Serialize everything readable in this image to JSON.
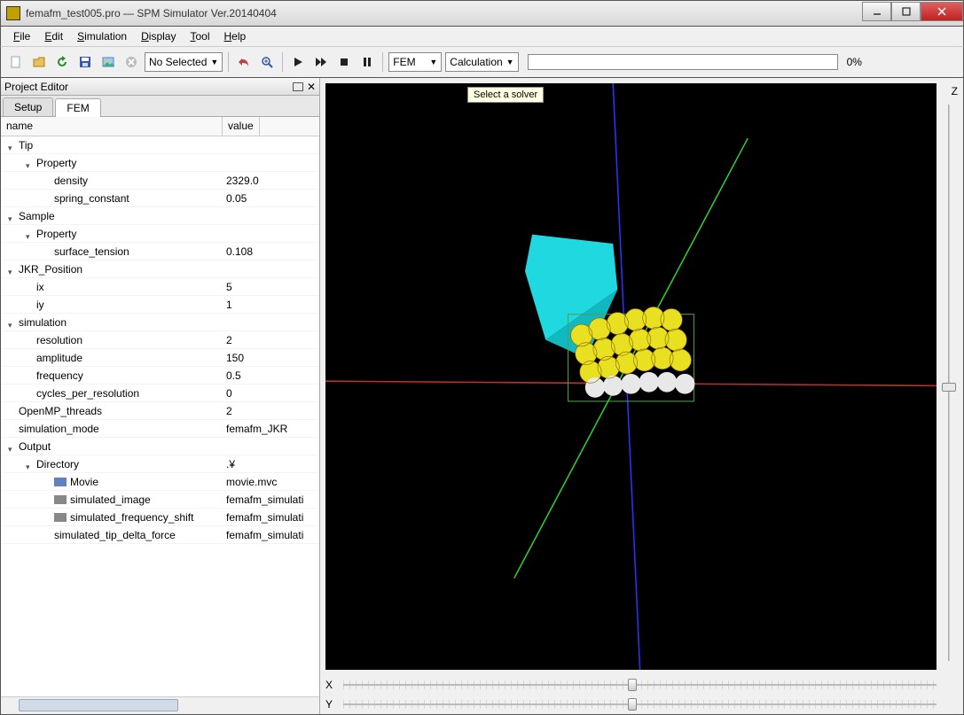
{
  "window": {
    "title": "femafm_test005.pro — SPM Simulator Ver.20140404"
  },
  "menu": {
    "file": "File",
    "edit": "Edit",
    "simulation": "Simulation",
    "display": "Display",
    "tool": "Tool",
    "help": "Help"
  },
  "toolbar": {
    "combo_noselected": "No Selected",
    "solver": "FEM",
    "mode": "Calculation",
    "progress_pct": "0%"
  },
  "panel": {
    "title": "Project Editor",
    "tab_setup": "Setup",
    "tab_fem": "FEM",
    "col_name": "name",
    "col_value": "value"
  },
  "tree": [
    {
      "indent": 0,
      "tw": true,
      "name": "Tip",
      "value": ""
    },
    {
      "indent": 1,
      "tw": true,
      "name": "Property",
      "value": ""
    },
    {
      "indent": 2,
      "tw": false,
      "name": "density",
      "value": "2329.0"
    },
    {
      "indent": 2,
      "tw": false,
      "name": "spring_constant",
      "value": "0.05"
    },
    {
      "indent": 0,
      "tw": true,
      "name": "Sample",
      "value": ""
    },
    {
      "indent": 1,
      "tw": true,
      "name": "Property",
      "value": ""
    },
    {
      "indent": 2,
      "tw": false,
      "name": "surface_tension",
      "value": "0.108"
    },
    {
      "indent": 0,
      "tw": true,
      "name": "JKR_Position",
      "value": ""
    },
    {
      "indent": 1,
      "tw": false,
      "name": "ix",
      "value": "5"
    },
    {
      "indent": 1,
      "tw": false,
      "name": "iy",
      "value": "1"
    },
    {
      "indent": 0,
      "tw": true,
      "name": "simulation",
      "value": ""
    },
    {
      "indent": 1,
      "tw": false,
      "name": "resolution",
      "value": "2"
    },
    {
      "indent": 1,
      "tw": false,
      "name": "amplitude",
      "value": "150"
    },
    {
      "indent": 1,
      "tw": false,
      "name": "frequency",
      "value": "0.5"
    },
    {
      "indent": 1,
      "tw": false,
      "name": "cycles_per_resolution",
      "value": "0"
    },
    {
      "indent": 0,
      "tw": false,
      "name": "OpenMP_threads",
      "value": "2"
    },
    {
      "indent": 0,
      "tw": false,
      "name": "simulation_mode",
      "value": "femafm_JKR"
    },
    {
      "indent": 0,
      "tw": true,
      "name": "Output",
      "value": ""
    },
    {
      "indent": 1,
      "tw": true,
      "name": "Directory",
      "value": ".¥"
    },
    {
      "indent": 2,
      "tw": false,
      "icon": "blue",
      "name": "Movie",
      "value": "movie.mvc"
    },
    {
      "indent": 2,
      "tw": false,
      "icon": "grey",
      "name": "simulated_image",
      "value": "femafm_simulati"
    },
    {
      "indent": 2,
      "tw": false,
      "icon": "grey",
      "name": "simulated_frequency_shift",
      "value": "femafm_simulati"
    },
    {
      "indent": 2,
      "tw": false,
      "name": "simulated_tip_delta_force",
      "value": "femafm_simulati"
    }
  ],
  "viewport": {
    "tooltip": "Select a solver",
    "axis_x": "X",
    "axis_y": "Y",
    "axis_z": "Z"
  }
}
